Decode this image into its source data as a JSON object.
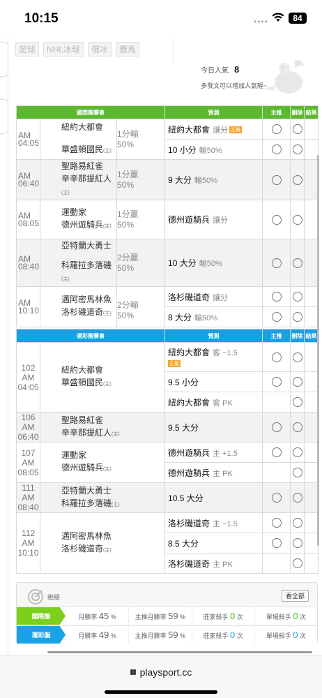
{
  "status": {
    "time": "10:15",
    "battery": "84"
  },
  "sport_tags": [
    "足球",
    "NHL冰球",
    "俄冰",
    "賽馬"
  ],
  "popularity": {
    "label": "今日人氣",
    "value": "8",
    "hint": "多發文可以增加人氣喔~"
  },
  "intl": {
    "headers": [
      "國際盤賽事",
      "預測",
      "主推",
      "刪除",
      "結果"
    ],
    "games": [
      {
        "time": "AM 04:05",
        "away": "紐約大都會",
        "home": "華盛頓國民",
        "home_tag": "(主)",
        "odds": [
          "1分輸",
          "50%"
        ],
        "picks": [
          {
            "team": "紐約大都會",
            "note": "讓分",
            "badge": "主推"
          },
          {
            "team": "10 小分",
            "note": "輸50%"
          }
        ]
      },
      {
        "time": "AM 06:40",
        "away": "聖路易紅雀",
        "home": "辛辛那提紅人",
        "home_tag": "(主)",
        "odds": [
          "1分贏",
          "50%"
        ],
        "picks": [
          {
            "team": "9 大分",
            "note": "輸50%"
          }
        ]
      },
      {
        "time": "AM 08:05",
        "away": "運動家",
        "home": "德州遊騎兵",
        "home_tag": "(主)",
        "odds": [
          "1分贏",
          "50%"
        ],
        "picks": [
          {
            "team": "德州遊騎兵",
            "note": "讓分"
          }
        ]
      },
      {
        "time": "AM 08:40",
        "away": "亞特蘭大勇士",
        "home": "科羅拉多落磯",
        "home_tag": "(主)",
        "odds": [
          "2分贏",
          "50%"
        ],
        "picks": [
          {
            "team": "10 大分",
            "note": "輸50%"
          }
        ]
      },
      {
        "time": "AM 10:10",
        "away": "邁阿密馬林魚",
        "home": "洛杉磯道奇",
        "home_tag": "(主)",
        "odds": [
          "2分輸",
          "50%"
        ],
        "picks": [
          {
            "team": "洛杉磯道奇",
            "note": "讓分"
          },
          {
            "team": "8 大分",
            "note": "輸50%"
          }
        ]
      }
    ]
  },
  "lottery": {
    "headers": [
      "運彩盤賽事",
      "預測",
      "主推",
      "刪除",
      "結果"
    ],
    "games": [
      {
        "num": "102",
        "time": "AM 04:05",
        "away": "紐約大都會",
        "home": "華盛頓國民",
        "home_tag": "(主)",
        "picks": [
          {
            "team": "紐約大都會",
            "note": "客 −1.5",
            "badge": "主推"
          },
          {
            "team": "9.5 小分",
            "note": ""
          },
          {
            "team": "紐約大都會",
            "note": "客 PK"
          }
        ]
      },
      {
        "num": "106",
        "time": "AM 06:40",
        "away": "聖路易紅雀",
        "home": "辛辛那提紅人",
        "home_tag": "(主)",
        "picks": [
          {
            "team": "9.5 大分",
            "note": ""
          }
        ]
      },
      {
        "num": "107",
        "time": "AM 08:05",
        "away": "運動家",
        "home": "德州遊騎兵",
        "home_tag": "(主)",
        "picks": [
          {
            "team": "德州遊騎兵",
            "note": "主 +1.5"
          },
          {
            "team": "德州遊騎兵",
            "note": "主 PK"
          }
        ]
      },
      {
        "num": "111",
        "time": "AM 08:40",
        "away": "亞特蘭大勇士",
        "home": "科羅拉多落磯",
        "home_tag": "(主)",
        "picks": [
          {
            "team": "10.5 大分",
            "note": ""
          }
        ]
      },
      {
        "num": "112",
        "time": "AM 10:10",
        "away": "邁阿密馬林魚",
        "home": "洛杉磯道奇",
        "home_tag": "(主)",
        "picks": [
          {
            "team": "洛杉磯道奇",
            "note": "主 −1.5"
          },
          {
            "team": "8.5 大分",
            "note": ""
          },
          {
            "team": "洛杉磯道奇",
            "note": "主 PK"
          }
        ]
      }
    ]
  },
  "record": {
    "title": "戰績",
    "view_all": "看全部",
    "rows": [
      {
        "label": "國際盤",
        "monthly_label": "月勝率",
        "monthly": "45",
        "push_label": "主推月勝率",
        "push": "59",
        "killer_label": "莊家殺手",
        "killer": "0",
        "single_label": "單場殺手",
        "single": "0",
        "pct": "%",
        "unit": "次"
      },
      {
        "label": "運彩盤",
        "monthly_label": "月勝率",
        "monthly": "49",
        "push_label": "主推月勝率",
        "push": "59",
        "killer_label": "莊家殺手",
        "killer": "0",
        "single_label": "單場殺手",
        "single": "0",
        "pct": "%",
        "unit": "次"
      }
    ]
  },
  "url": "playsport.cc",
  "colors": {
    "green": "#5cb82f",
    "blue": "#1a9fe3",
    "orange": "#f39a3b"
  }
}
